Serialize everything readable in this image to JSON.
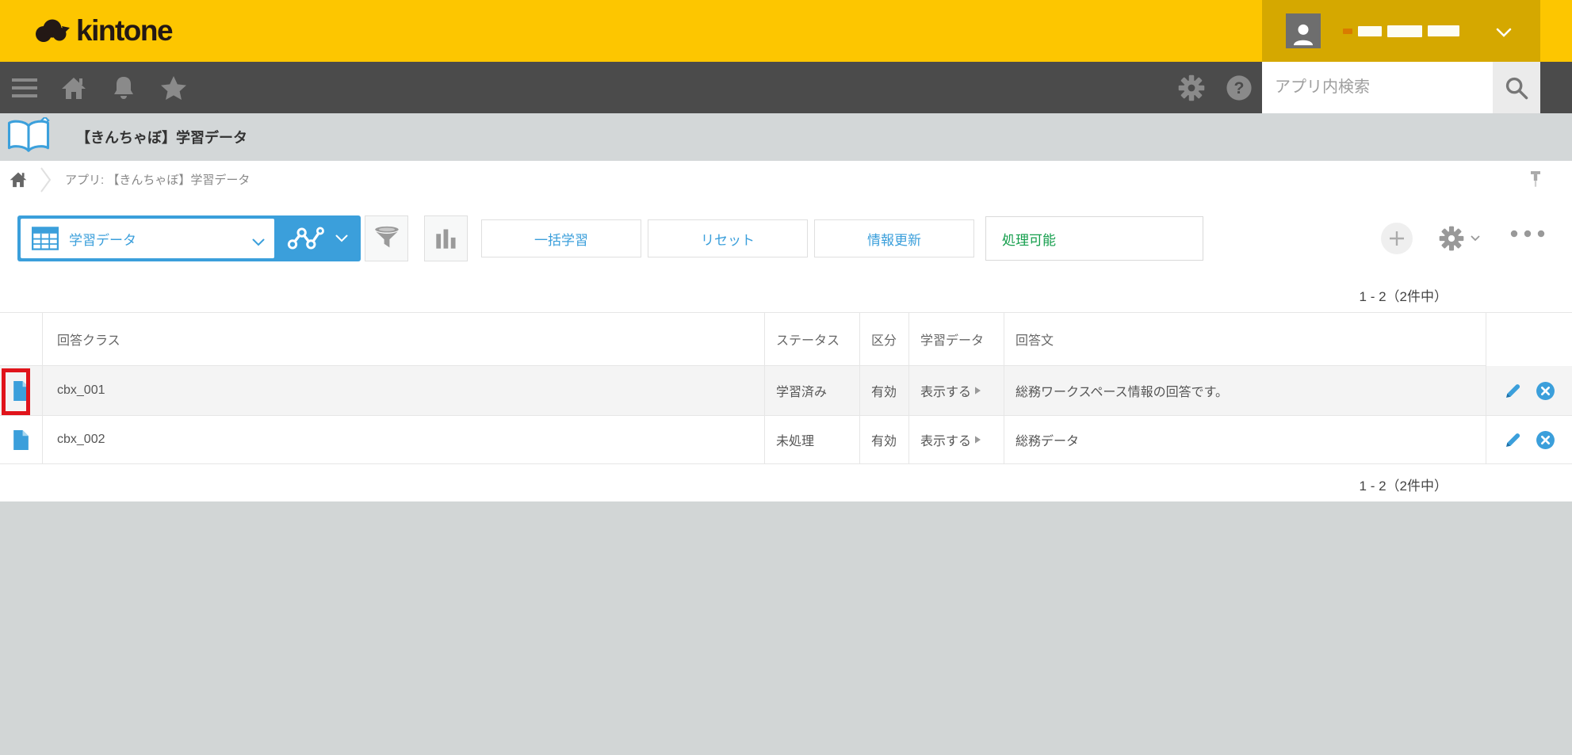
{
  "brand": {
    "logo_text": "kintone"
  },
  "navbar": {
    "search": {
      "placeholder": "アプリ内検索",
      "value": ""
    }
  },
  "app_header": {
    "title": "【きんちゃぼ】学習データ"
  },
  "breadcrumb": {
    "label": "アプリ: 【きんちゃぼ】学習データ"
  },
  "toolbar": {
    "view_selector": {
      "selected": "学習データ"
    },
    "actions": [
      {
        "label": "一括学習"
      },
      {
        "label": "リセット"
      },
      {
        "label": "情報更新"
      }
    ],
    "status_button": {
      "label": "処理可能"
    }
  },
  "pagination": {
    "top": "1 - 2（2件中）",
    "bottom": "1 - 2（2件中）"
  },
  "table": {
    "columns": {
      "answer_class": "回答クラス",
      "status": "ステータス",
      "category": "区分",
      "learning_data": "学習データ",
      "answer_text": "回答文"
    },
    "rows": [
      {
        "answer_class": "cbx_001",
        "status": "学習済み",
        "category": "有効",
        "learning_data": "表示する",
        "answer_text": "総務ワークスペース情報の回答です。"
      },
      {
        "answer_class": "cbx_002",
        "status": "未処理",
        "category": "有効",
        "learning_data": "表示する",
        "answer_text": "総務データ"
      }
    ]
  },
  "icons": {
    "help_glyph": "?"
  },
  "colors": {
    "brand_yellow": "#FDC600",
    "user_area_gold": "#D5A800",
    "nav_gray": "#4B4B4B",
    "accent_blue": "#3B9FDB",
    "status_green": "#149E4C",
    "annotation_red": "#E0141B",
    "row_highlight_bg": "#F4F4F4"
  }
}
